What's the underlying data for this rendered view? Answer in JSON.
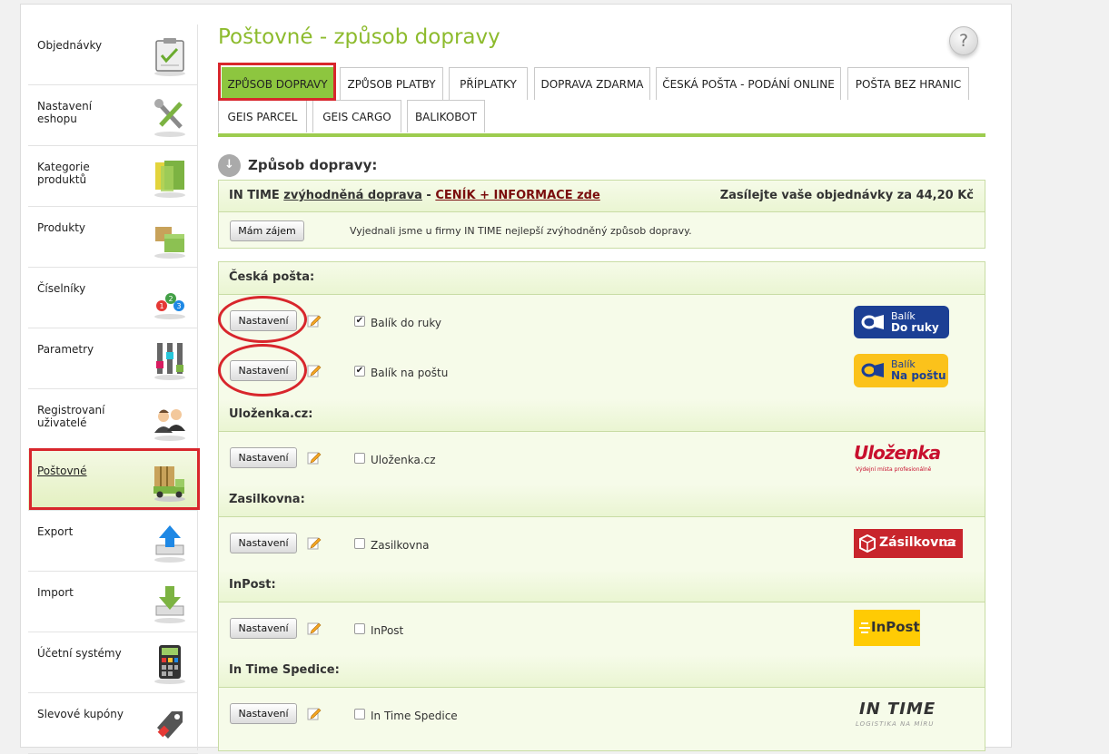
{
  "page": {
    "title": "Poštovné - způsob dopravy",
    "help": "?"
  },
  "sidebar": {
    "items": [
      {
        "label": "Objednávky",
        "icon": "clipboard-icon"
      },
      {
        "label": "Nastavení eshopu",
        "icon": "tools-icon"
      },
      {
        "label": "Kategorie produktů",
        "icon": "folder-icon"
      },
      {
        "label": "Produkty",
        "icon": "boxes-icon"
      },
      {
        "label": "Číselníky",
        "icon": "numbers-icon"
      },
      {
        "label": "Parametry",
        "icon": "sliders-icon"
      },
      {
        "label": "Registrovaní uživatelé",
        "icon": "users-icon"
      },
      {
        "label": "Poštovné",
        "icon": "truck-icon",
        "active": true
      },
      {
        "label": "Export",
        "icon": "upload-icon"
      },
      {
        "label": "Import",
        "icon": "download-icon"
      },
      {
        "label": "Účetní systémy",
        "icon": "calculator-icon"
      },
      {
        "label": "Slevové kupóny",
        "icon": "tag-icon"
      }
    ]
  },
  "tabs": [
    {
      "label": "ZPŮSOB DOPRAVY",
      "active": true
    },
    {
      "label": "ZPŮSOB PLATBY"
    },
    {
      "label": "PŘÍPLATKY"
    },
    {
      "label": "DOPRAVA ZDARMA"
    },
    {
      "label": "ČESKÁ POŠTA - PODÁNÍ ONLINE"
    },
    {
      "label": "POŠTA BEZ HRANIC"
    },
    {
      "label": "GEIS PARCEL"
    },
    {
      "label": "GEIS CARGO"
    },
    {
      "label": "BALIKOBOT"
    }
  ],
  "section": {
    "title": "Způsob dopravy:"
  },
  "intime_promo": {
    "brand": "IN TIME",
    "link_text": "zvýhodněná doprava",
    "separator": " - ",
    "cta": "CENÍK + INFORMACE zde",
    "right_text": "Zasílejte vaše objednávky za 44,20 Kč",
    "button": "Mám zájem",
    "description": "Vyjednali jsme u firmy IN TIME nejlepší zvýhodněný způsob dopravy."
  },
  "carriers": {
    "ceska_posta": {
      "header": "Česká pošta:",
      "rows": [
        {
          "button": "Nastavení",
          "label": "Balík do ruky",
          "checked": true,
          "logo": {
            "line1": "Balík",
            "line2": "Do ruky"
          }
        },
        {
          "button": "Nastavení",
          "label": "Balík na poštu",
          "checked": true,
          "logo": {
            "line1": "Balík",
            "line2": "Na poštu"
          }
        }
      ]
    },
    "ulozenka": {
      "header": "Uloženka.cz:",
      "rows": [
        {
          "button": "Nastavení",
          "label": "Uloženka.cz",
          "checked": false,
          "logo": {
            "line1": "Uloženka",
            "line2": "Výdejní místa profesionálně"
          }
        }
      ]
    },
    "zasilkovna": {
      "header": "Zasilkovna:",
      "rows": [
        {
          "button": "Nastavení",
          "label": "Zasilkovna",
          "checked": false,
          "logo": {
            "line1": "Zásilkovna",
            "line2": ".cz"
          }
        }
      ]
    },
    "inpost": {
      "header": "InPost:",
      "rows": [
        {
          "button": "Nastavení",
          "label": "InPost",
          "checked": false,
          "logo": {
            "line1": "InPost"
          }
        }
      ]
    },
    "intime": {
      "header": "In Time Spedice:",
      "rows": [
        {
          "button": "Nastavení",
          "label": "In Time Spedice",
          "checked": false,
          "logo": {
            "line1": "IN TIME",
            "line2": "LOGISTIKA NA MÍRU"
          }
        }
      ]
    }
  },
  "colors": {
    "accent": "#8dc63f",
    "title": "#8dbb2d",
    "highlight": "#d8262c"
  }
}
